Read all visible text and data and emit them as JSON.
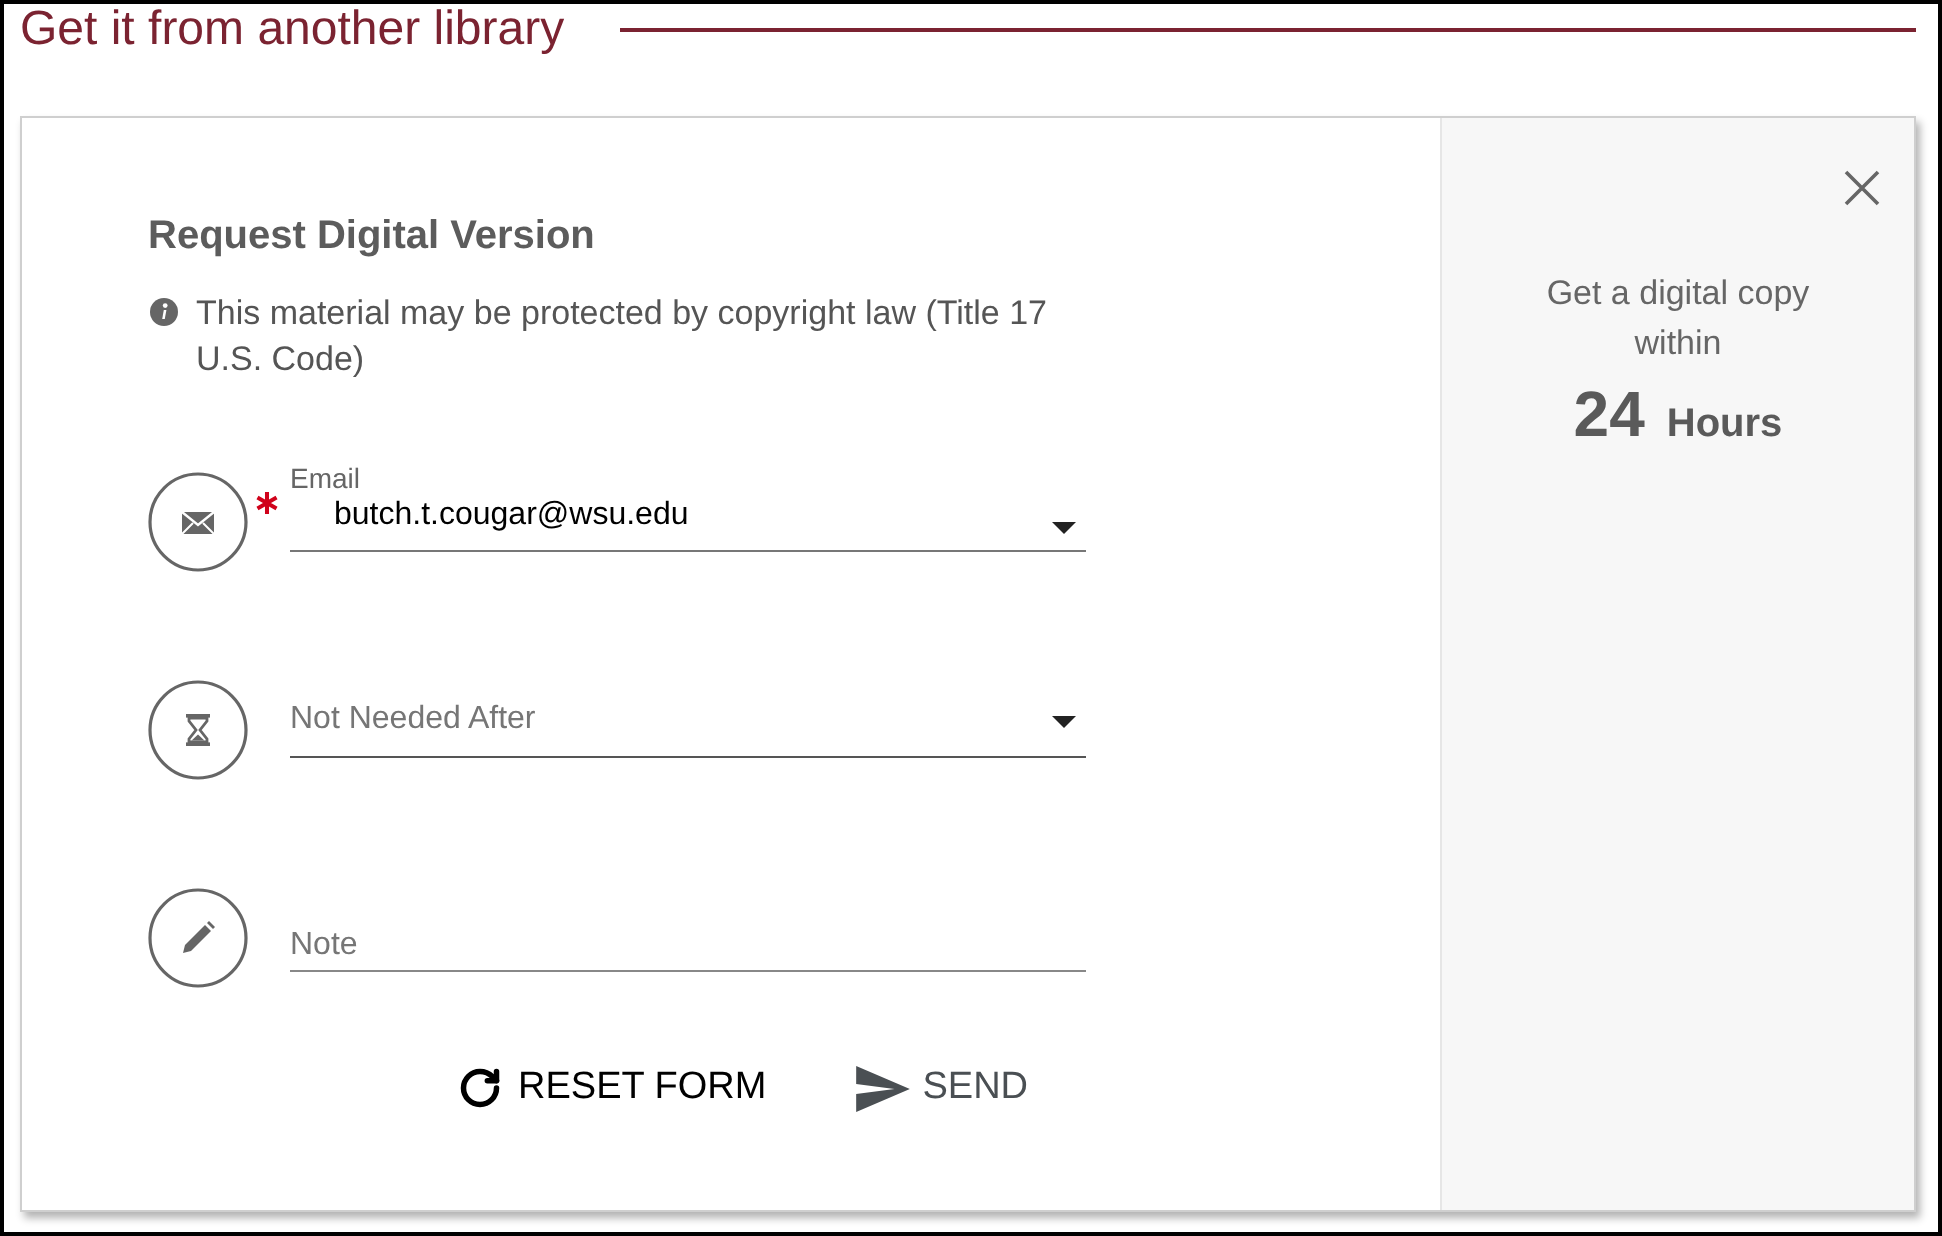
{
  "section": {
    "title": "Get it from another library"
  },
  "form": {
    "title": "Request Digital Version",
    "notice": "This material may be protected by copyright law (Title 17 U.S. Code)",
    "fields": [
      {
        "kind": "email",
        "label": "Email",
        "value": "butch.t.cougar@wsu.edu",
        "required": true
      },
      {
        "kind": "date",
        "placeholder": "Not Needed After",
        "required": false
      },
      {
        "kind": "note",
        "placeholder": "Note",
        "required": false
      }
    ],
    "buttons": [
      {
        "kind": "reset",
        "label": "RESET FORM"
      },
      {
        "kind": "send",
        "label": "SEND"
      }
    ]
  },
  "side_panel": {
    "text": "Get a digital copy within",
    "number": "24",
    "unit": "Hours"
  }
}
